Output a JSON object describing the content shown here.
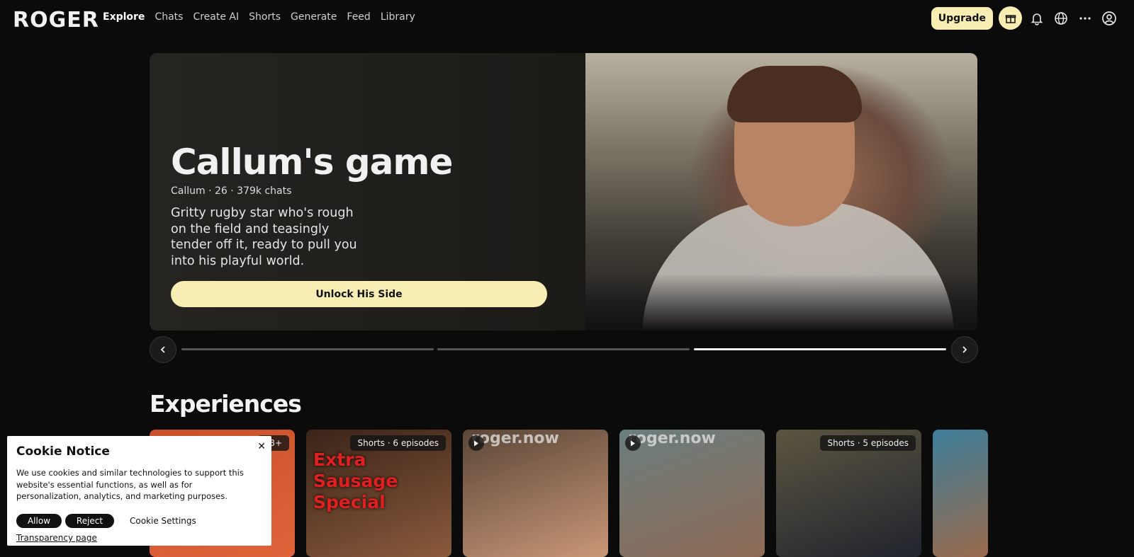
{
  "app": {
    "logo": "ROGER"
  },
  "nav": {
    "items": [
      "Explore",
      "Chats",
      "Create AI",
      "Shorts",
      "Generate",
      "Feed",
      "Library"
    ],
    "active": "Explore"
  },
  "header": {
    "upgrade_label": "Upgrade"
  },
  "hero": {
    "title": "Callum's game",
    "meta": "Callum · 26 · 379k chats",
    "description": "Gritty rugby star who's rough on the field and teasingly tender off it, ready to pull you into his playful world.",
    "cta_label": "Unlock His Side",
    "slides": {
      "count": 3,
      "active_index": 3
    }
  },
  "section": {
    "title": "Experiences"
  },
  "cards": [
    {
      "badge": "18+",
      "text": "",
      "watermark": "",
      "play": false,
      "colors": [
        "#c9502b",
        "#e0643a"
      ]
    },
    {
      "badge": "Shorts · 6 episodes",
      "text": "Extra Sausage Special",
      "watermark": "",
      "play": false,
      "colors": [
        "#3a2418",
        "#8a5a3c"
      ]
    },
    {
      "badge": "",
      "text": "",
      "watermark": "roger.now",
      "play": true,
      "colors": [
        "#5a4637",
        "#c99777"
      ]
    },
    {
      "badge": "",
      "text": "",
      "watermark": "roger.now",
      "play": true,
      "colors": [
        "#6b7e7e",
        "#8e6a55"
      ]
    },
    {
      "badge": "Shorts · 5 episodes",
      "text": "",
      "watermark": "",
      "play": false,
      "colors": [
        "#5c5540",
        "#20242e"
      ]
    },
    {
      "badge": "",
      "text": "",
      "watermark": "",
      "play": false,
      "colors": [
        "#3d7e9a",
        "#9a6a4c"
      ]
    }
  ],
  "cookie": {
    "title": "Cookie Notice",
    "body": "We use cookies and similar technologies to support this website's essential functions, as well as for personalization, analytics, and marketing purposes.",
    "allow": "Allow",
    "reject": "Reject",
    "settings": "Cookie Settings",
    "transparency": "Transparency page"
  },
  "colors": {
    "accent": "#f8edb3",
    "background": "#0b0b0b"
  }
}
